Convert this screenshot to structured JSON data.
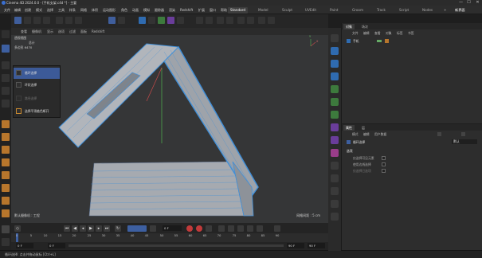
{
  "titlebar": {
    "title": "Cinema 4D 2024.0.0 - [手机支架.c4d *] - 主要",
    "min": "—",
    "max": "☐",
    "close": "✕"
  },
  "menubar": {
    "items": [
      "文件",
      "编辑",
      "创建",
      "模式",
      "选择",
      "工具",
      "样条",
      "网格",
      "体积",
      "运动图形",
      "角色",
      "动画",
      "模拟",
      "跟踪器",
      "渲染",
      "Redshift",
      "扩展",
      "窗口",
      "帮助"
    ],
    "layouts": [
      "Standard",
      "Model",
      "Sculpt",
      "UVEdit",
      "Paint",
      "Groom",
      "Track",
      "Script",
      "Nodes"
    ],
    "active_layout": "Standard",
    "new_layout_btn": "+",
    "right_label": "新界面"
  },
  "viewport": {
    "menu": [
      "查看",
      "摄像机",
      "显示",
      "选项",
      "过滤",
      "面板",
      "Redshift"
    ],
    "label": "透视视图",
    "stats": {
      "line1_label": "总计",
      "line2_label": "多边形",
      "line2_value": "6470"
    },
    "footer_left": "默认摄像机 : 工程",
    "footer_right": "网格间距 : 5 cm",
    "axis_y": "Y",
    "axis_x": "X"
  },
  "popup": {
    "items": [
      {
        "label": "循环选择",
        "state": "hover"
      },
      {
        "label": "环状选择",
        "state": "normal"
      },
      {
        "label": "路径选择",
        "state": "disabled"
      },
      {
        "label": "选择平滑着色断开",
        "state": "normal"
      }
    ]
  },
  "timeline": {
    "current_frame": "0 F",
    "ticks": [
      "0",
      "5",
      "10",
      "15",
      "20",
      "25",
      "30",
      "35",
      "40",
      "45",
      "50",
      "55",
      "60",
      "65",
      "70",
      "75",
      "80",
      "85",
      "90"
    ],
    "start": "0 F",
    "start2": "0 F",
    "end2": "90 F",
    "end": "90 F"
  },
  "status": {
    "text": "循环选择: 点击并拖动鼠标 [Ctrl+L]"
  },
  "objects": {
    "tabs": [
      "对象",
      "场次"
    ],
    "menu": [
      "文件",
      "编辑",
      "查看",
      "对象",
      "标签",
      "书签"
    ],
    "items": [
      {
        "name": "手机"
      }
    ]
  },
  "attributes": {
    "tabs": [
      "属性",
      "层"
    ],
    "menu": [
      "模式",
      "编辑",
      "用户数据"
    ],
    "mode_label": "循环选择",
    "dropdown": "默认",
    "section": "选项",
    "options": [
      {
        "label": "仅选择可见元素"
      },
      {
        "label": "使用边线选择"
      },
      {
        "label": "仅选择已选项"
      }
    ]
  },
  "colors": {
    "accent": "#3d5fa0",
    "model_gray": "#aeb2b8",
    "model_blue": "#3f8fd9",
    "record": "#c23a3a"
  }
}
